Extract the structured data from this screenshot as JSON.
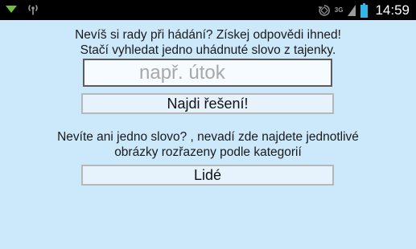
{
  "status_bar": {
    "network_type": "3G",
    "time": "14:59"
  },
  "main": {
    "intro_line1": "Nevíš si rady při hádání? Získej odpovědi ihned!",
    "intro_line2": "Stačí vyhledat jedno uhádnuté slovo z tajenky.",
    "search": {
      "value": "",
      "placeholder": "např. útok"
    },
    "solve_button": "Najdi řešení!",
    "hint_line1": "Nevíte ani jedno slovo? , nevadí zde najdete jednotlivé",
    "hint_line2": "obrázky rozřazeny podle kategorií",
    "category_button": "Lidé"
  },
  "colors": {
    "background": "#cce9fb",
    "status_bar": "#000000",
    "notification_green": "#6fbf3a",
    "battery_cyan": "#33b5e5"
  },
  "icons": [
    "download-notification-icon",
    "wifi-hotspot-icon",
    "rotate-icon",
    "signal-icon",
    "battery-icon"
  ]
}
